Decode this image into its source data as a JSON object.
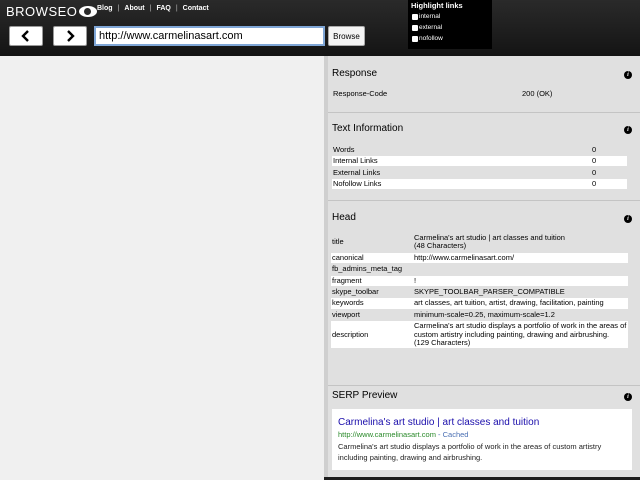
{
  "app": {
    "logo_text": "BROWSEO",
    "nav": [
      "Blog",
      "About",
      "FAQ",
      "Contact"
    ]
  },
  "toolbar": {
    "url_value": "http://www.carmelinasart.com",
    "browse_label": "Browse",
    "back_icon": "chevron-left-icon",
    "forward_icon": "chevron-right-icon"
  },
  "highlight": {
    "title": "Highlight links",
    "options": [
      "internal",
      "external",
      "nofollow"
    ]
  },
  "response": {
    "title": "Response",
    "label": "Response-Code",
    "value": "200 (OK)"
  },
  "text_info": {
    "title": "Text Information",
    "rows": [
      {
        "label": "Words",
        "value": "0"
      },
      {
        "label": "Internal Links",
        "value": "0"
      },
      {
        "label": "External Links",
        "value": "0"
      },
      {
        "label": "Nofollow Links",
        "value": "0"
      }
    ]
  },
  "head": {
    "title": "Head",
    "rows": [
      {
        "key": "title",
        "value": "Carmelina's art studio | art classes and tuition",
        "extra": "(48 Characters)"
      },
      {
        "key": "canonical",
        "value": "http://www.carmelinasart.com/",
        "extra": ""
      },
      {
        "key": "fb_admins_meta_tag",
        "value": "",
        "extra": ""
      },
      {
        "key": "fragment",
        "value": "!",
        "extra": ""
      },
      {
        "key": "skype_toolbar",
        "value": "SKYPE_TOOLBAR_PARSER_COMPATIBLE",
        "extra": ""
      },
      {
        "key": "keywords",
        "value": "art classes, art tuition, artist, drawing, facilitation, painting",
        "extra": ""
      },
      {
        "key": "viewport",
        "value": "minimum-scale=0.25, maximum-scale=1.2",
        "extra": ""
      },
      {
        "key": "description",
        "value": "Carmelina's art studio displays a portfolio of work in the areas of custom artistry including painting, drawing and airbrushing.",
        "extra": "(129 Characters)"
      }
    ]
  },
  "serp": {
    "title": "SERP Preview",
    "result_title": "Carmelina's art studio | art classes and tuition",
    "result_url": "http://www.carmelinasart.com",
    "cached_label": "- Cached",
    "description": "Carmelina's art studio displays a portfolio of work in the areas of custom artistry including painting, drawing and airbrushing."
  },
  "colors": {
    "link_blue": "#1a0dab",
    "url_green": "#2a8a2a",
    "topbar": "#1e1e1e"
  }
}
